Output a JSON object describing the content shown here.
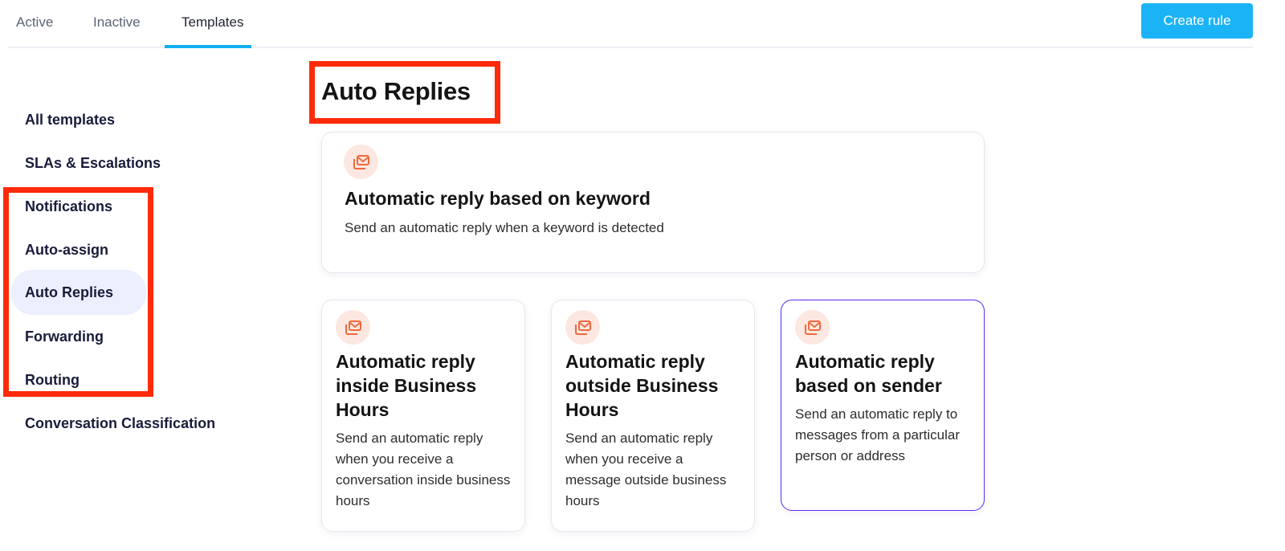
{
  "tabs": [
    {
      "label": "Active",
      "active": false
    },
    {
      "label": "Inactive",
      "active": false
    },
    {
      "label": "Templates",
      "active": true
    }
  ],
  "toolbar": {
    "create_rule_label": "Create rule"
  },
  "colors": {
    "accent": "#1ab4f6",
    "tab_underline": "#0fb0f2",
    "highlight_border": "#5b2cf0",
    "annotation_red": "#ff2a0a",
    "icon_bg": "#fde7e1",
    "icon_fg": "#ee6a3e",
    "selected_bg": "#eceffd"
  },
  "sidebar": {
    "items": [
      {
        "label": "All templates",
        "selected": false
      },
      {
        "label": "SLAs & Escalations",
        "selected": false
      },
      {
        "label": "Notifications",
        "selected": false
      },
      {
        "label": "Auto-assign",
        "selected": false
      },
      {
        "label": "Auto Replies",
        "selected": true
      },
      {
        "label": "Forwarding",
        "selected": false
      },
      {
        "label": "Routing",
        "selected": false
      },
      {
        "label": "Conversation Classification",
        "selected": false
      }
    ]
  },
  "main": {
    "title": "Auto Replies",
    "cards": [
      {
        "icon": "mail-stack-icon",
        "title": "Automatic reply based on keyword",
        "description": "Send an automatic reply when a keyword is detected",
        "highlighted": false
      },
      {
        "icon": "mail-stack-icon",
        "title": "Automatic reply inside Business Hours",
        "description": "Send an automatic reply when you receive a conversation inside business hours",
        "highlighted": false
      },
      {
        "icon": "mail-stack-icon",
        "title": "Automatic reply outside Business Hours",
        "description": "Send an automatic reply when you receive a message outside business hours",
        "highlighted": false
      },
      {
        "icon": "mail-stack-icon",
        "title": "Automatic reply based on sender",
        "description": "Send an automatic reply to messages from a particular person or address",
        "highlighted": true
      }
    ]
  }
}
